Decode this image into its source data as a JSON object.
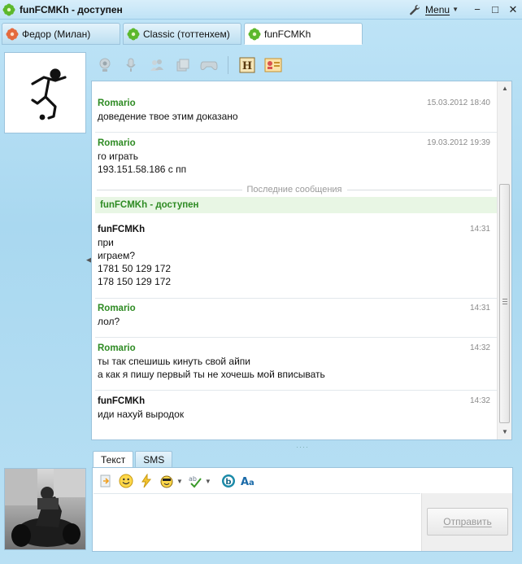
{
  "window": {
    "title": "funFCMKh - доступен",
    "menu_label": "Menu"
  },
  "tabs": [
    {
      "label": "Федор (Милан)",
      "icon": "contact-busy-icon"
    },
    {
      "label": "Classic (тоттенхем)",
      "icon": "contact-online-icon"
    },
    {
      "label": "funFCMKh",
      "icon": "contact-online-icon"
    }
  ],
  "chat": {
    "messages": [
      {
        "author": "Romario",
        "time": "15.03.2012 18:40",
        "lines": [
          "доведение твое этим доказано"
        ]
      },
      {
        "author": "Romario",
        "time": "19.03.2012 19:39",
        "lines": [
          "го играть",
          "193.151.58.186 с пп"
        ]
      },
      {
        "author": "funFCMKh",
        "time": "14:31",
        "lines": [
          "при",
          "играем?",
          "1781 50 129 172",
          "178 150 129 172"
        ]
      },
      {
        "author": "Romario",
        "time": "14:31",
        "lines": [
          "лол?"
        ]
      },
      {
        "author": "Romario",
        "time": "14:32",
        "lines": [
          "ты так спешишь кинуть свой айпи",
          "а как я пишу первый ты не хочешь мой вписывать"
        ]
      },
      {
        "author": "funFCMKh",
        "time": "14:32",
        "lines": [
          "иди нахуй выродок"
        ]
      }
    ],
    "divider_label": "Последние сообщения",
    "status_line": "funFCMKh - доступен"
  },
  "compose": {
    "tab_text": "Текст",
    "tab_sms": "SMS",
    "send_label": "Отправить",
    "input_value": ""
  },
  "colors": {
    "contact_name": "#2e8b23",
    "status_bg": "#e8f6e4",
    "window_bg": "#b3dcf2"
  }
}
